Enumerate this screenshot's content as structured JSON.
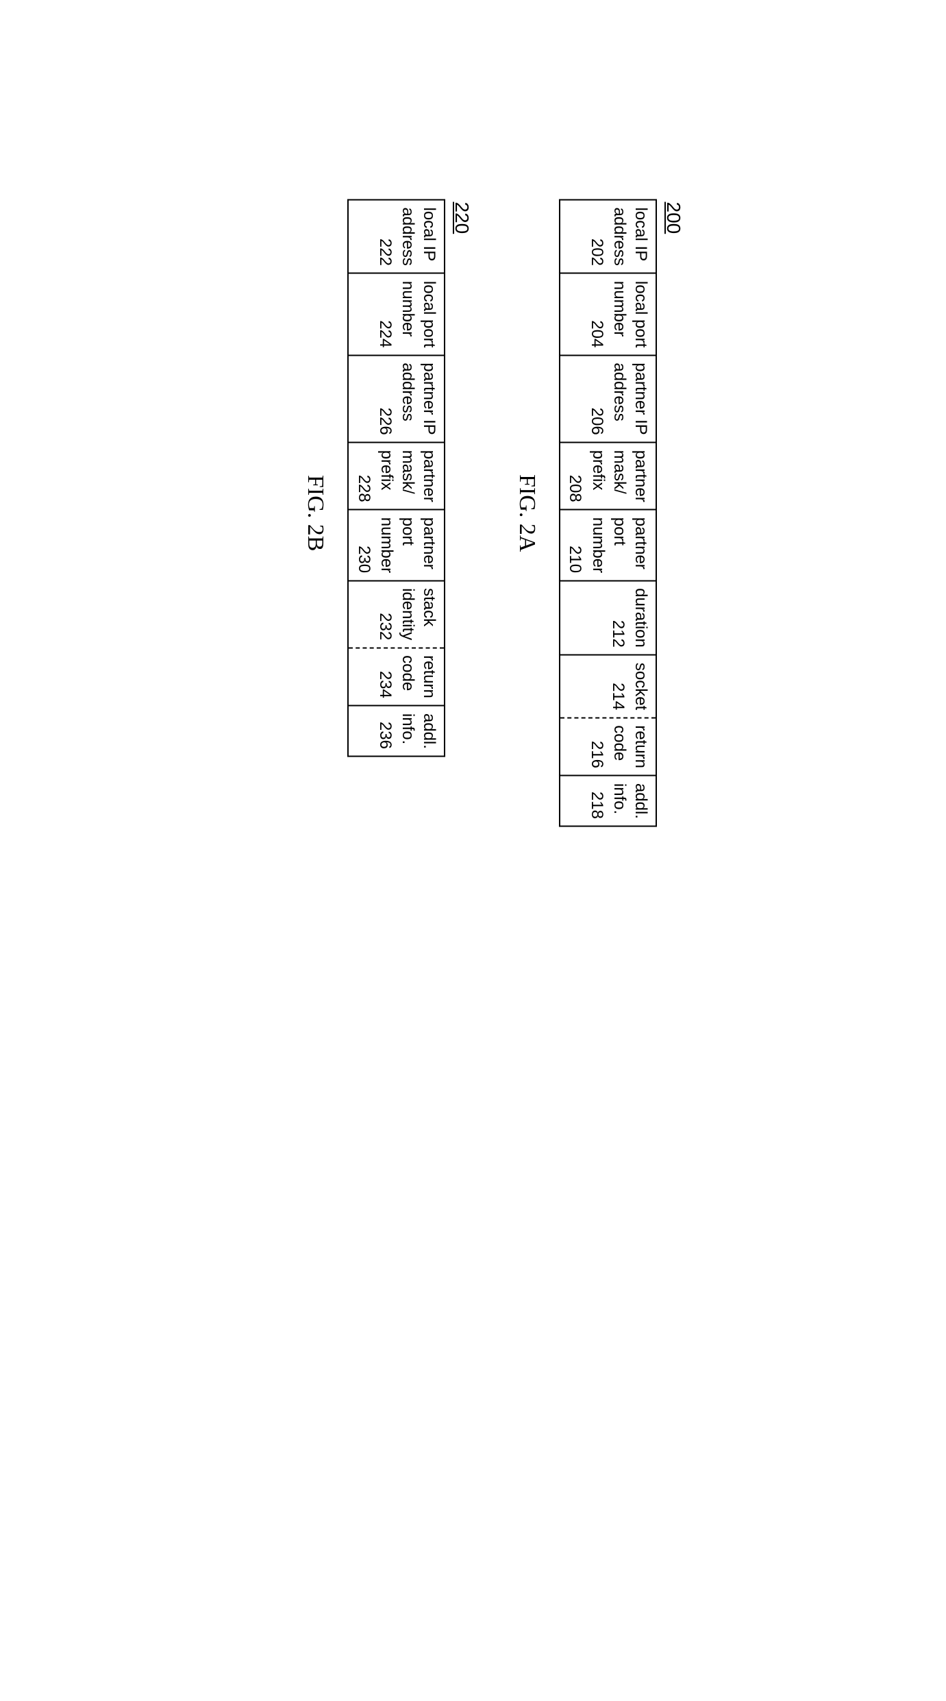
{
  "figA": {
    "ref": "200",
    "cells": [
      {
        "label": "local IP\naddress",
        "num": "202"
      },
      {
        "label": "local port\nnumber",
        "num": "204"
      },
      {
        "label": "partner IP\naddress",
        "num": "206"
      },
      {
        "label": "partner\nmask/\nprefix",
        "num": "208"
      },
      {
        "label": "partner\nport\nnumber",
        "num": "210"
      },
      {
        "label": "duration",
        "num": "212"
      },
      {
        "label": "socket",
        "num": "214"
      },
      {
        "label": "return\ncode",
        "num": "216"
      },
      {
        "label": "addl.\ninfo.",
        "num": "218"
      }
    ],
    "caption": "FIG. 2A"
  },
  "figB": {
    "ref": "220",
    "cells": [
      {
        "label": "local IP\naddress",
        "num": "222"
      },
      {
        "label": "local port\nnumber",
        "num": "224"
      },
      {
        "label": "partner IP\naddress",
        "num": "226"
      },
      {
        "label": "partner\nmask/\nprefix",
        "num": "228"
      },
      {
        "label": "partner\nport\nnumber",
        "num": "230"
      },
      {
        "label": "stack\nidentity",
        "num": "232"
      },
      {
        "label": "return\ncode",
        "num": "234"
      },
      {
        "label": "addl.\ninfo.",
        "num": "236"
      }
    ],
    "caption": "FIG. 2B"
  }
}
